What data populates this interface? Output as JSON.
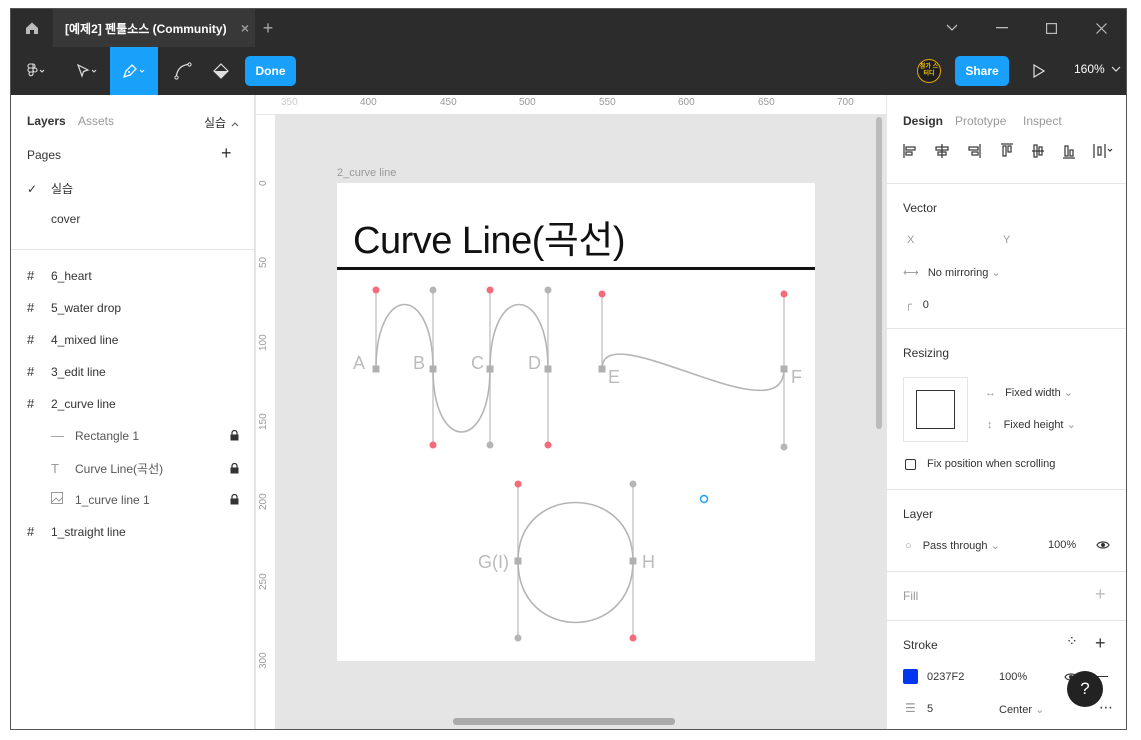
{
  "window": {
    "tab_title": "[예제2] 펜툴소스 (Community)",
    "tab_close": "×",
    "new_tab": "+"
  },
  "toolbar": {
    "done_label": "Done",
    "share_label": "Share",
    "zoom": "160%",
    "avatar_text": "참가 스터디"
  },
  "left_panel": {
    "tabs": [
      "Layers",
      "Assets"
    ],
    "page_selector": "실습",
    "pages_label": "Pages",
    "pages": [
      {
        "label": "실습",
        "selected": true
      },
      {
        "label": "cover",
        "selected": false
      }
    ],
    "layers": [
      {
        "label": "6_heart",
        "type": "frame"
      },
      {
        "label": "5_water drop",
        "type": "frame"
      },
      {
        "label": "4_mixed line",
        "type": "frame"
      },
      {
        "label": "3_edit line",
        "type": "frame"
      },
      {
        "label": "2_curve line",
        "type": "frame"
      },
      {
        "label": "Rectangle 1",
        "type": "line",
        "locked": true
      },
      {
        "label": "Curve Line(곡선)",
        "type": "text",
        "locked": true
      },
      {
        "label": "1_curve line 1",
        "type": "image",
        "locked": true
      },
      {
        "label": "1_straight line",
        "type": "frame"
      }
    ]
  },
  "canvas": {
    "ruler_top": [
      "350",
      "400",
      "450",
      "500",
      "550",
      "600",
      "650",
      "700"
    ],
    "ruler_left": [
      "0",
      "50",
      "100",
      "150",
      "200",
      "250",
      "300"
    ],
    "frame_label": "2_curve line",
    "frame_title": "Curve Line(곡선)",
    "point_labels": [
      "A",
      "B",
      "C",
      "D",
      "E",
      "F",
      "G(I)",
      "H"
    ]
  },
  "right_panel": {
    "tabs": [
      "Design",
      "Prototype",
      "Inspect"
    ],
    "vector": {
      "title": "Vector",
      "x_label": "X",
      "y_label": "Y",
      "mirroring": "No mirroring",
      "corner_radius": "0"
    },
    "resizing": {
      "title": "Resizing",
      "width_mode": "Fixed width",
      "height_mode": "Fixed height",
      "fix_position": "Fix position when scrolling"
    },
    "layer": {
      "title": "Layer",
      "blend": "Pass through",
      "opacity": "100%"
    },
    "fill": {
      "title": "Fill"
    },
    "stroke": {
      "title": "Stroke",
      "color_hex": "0237F2",
      "color": "#0237F2",
      "opacity": "100%",
      "weight": "5",
      "align": "Center"
    }
  },
  "help_label": "?"
}
